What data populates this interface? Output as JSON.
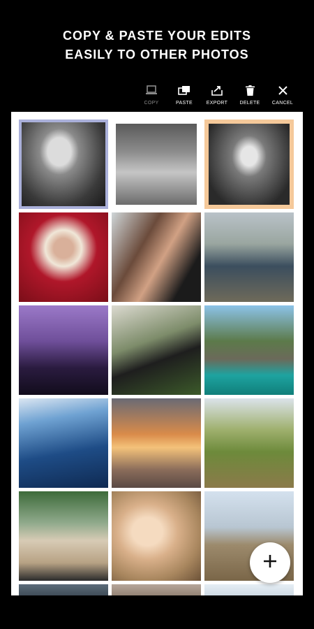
{
  "headline": {
    "line1": "COPY & PASTE YOUR EDITS",
    "line2": "EASILY TO OTHER PHOTOS"
  },
  "toolbar": {
    "items": [
      {
        "label": "COPY",
        "icon": "copy-icon",
        "enabled": false
      },
      {
        "label": "PASTE",
        "icon": "paste-icon",
        "enabled": true
      },
      {
        "label": "EXPORT",
        "icon": "export-icon",
        "enabled": true
      },
      {
        "label": "DELETE",
        "icon": "delete-icon",
        "enabled": true
      },
      {
        "label": "CANCEL",
        "icon": "close-icon",
        "enabled": true
      }
    ]
  },
  "colors": {
    "background": "#000000",
    "panel": "#ffffff",
    "selection_blue": "#aab0da",
    "selection_orange": "#f5c99a"
  },
  "fab": {
    "icon": "plus-icon"
  }
}
